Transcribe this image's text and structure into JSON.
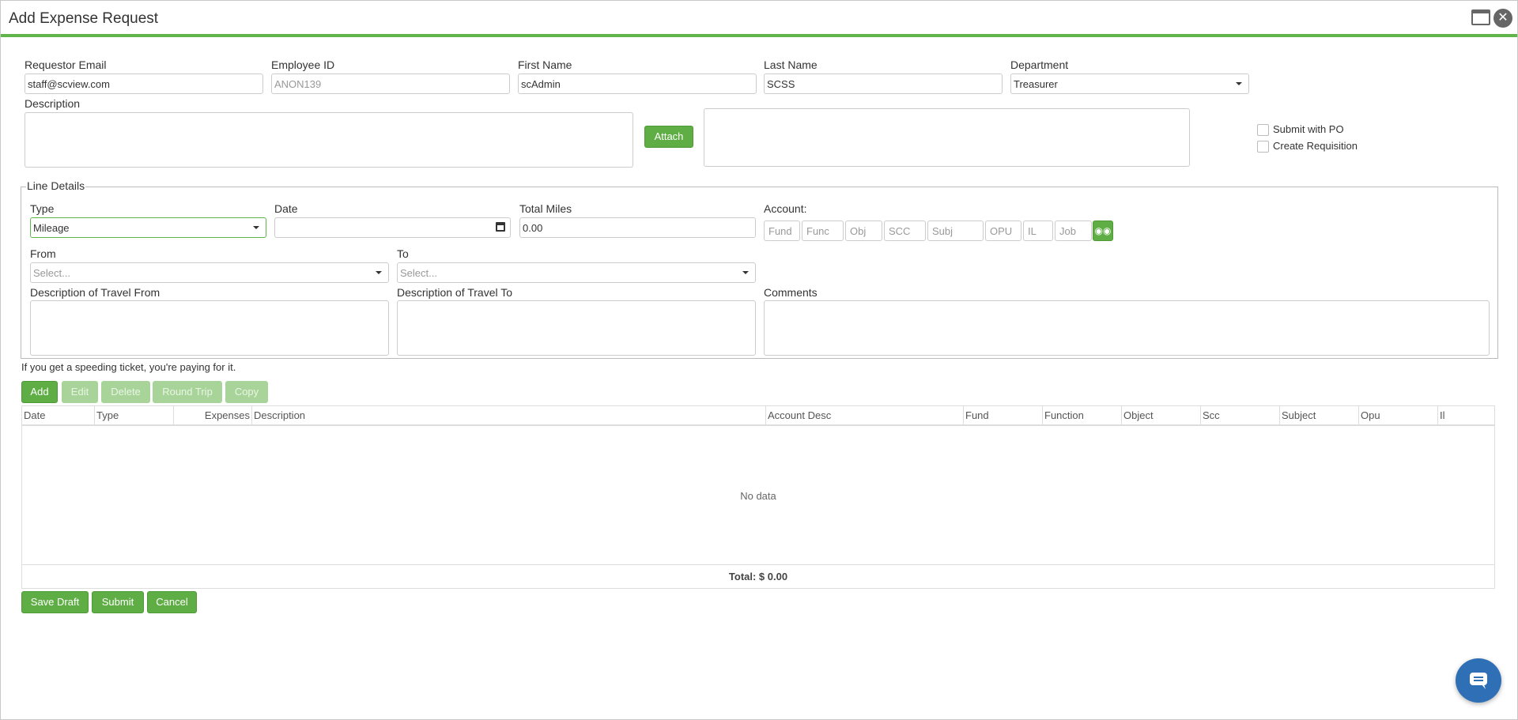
{
  "window": {
    "title": "Add Expense Request"
  },
  "header_fields": {
    "requestor_email": {
      "label": "Requestor Email",
      "value": "staff@scview.com"
    },
    "employee_id": {
      "label": "Employee ID",
      "value": "ANON139"
    },
    "first_name": {
      "label": "First Name",
      "value": "scAdmin"
    },
    "last_name": {
      "label": "Last Name",
      "value": "SCSS"
    },
    "department": {
      "label": "Department",
      "value": "Treasurer"
    },
    "description": {
      "label": "Description"
    },
    "attach_label": "Attach",
    "submit_with_po": "Submit with PO",
    "create_requisition": "Create Requisition"
  },
  "line_details": {
    "legend": "Line Details",
    "type": {
      "label": "Type",
      "value": "Mileage"
    },
    "date": {
      "label": "Date",
      "value": ""
    },
    "total_miles": {
      "label": "Total Miles",
      "value": "0.00"
    },
    "account": {
      "label": "Account:",
      "segments": [
        "Fund",
        "Func",
        "Obj",
        "SCC",
        "Subj",
        "OPU",
        "IL",
        "Job"
      ]
    },
    "from": {
      "label": "From",
      "placeholder": "Select..."
    },
    "to": {
      "label": "To",
      "placeholder": "Select..."
    },
    "desc_from": {
      "label": "Description of Travel From"
    },
    "desc_to": {
      "label": "Description of Travel To"
    },
    "comments": {
      "label": "Comments"
    }
  },
  "notice": "If you get a speeding ticket, you're paying for it.",
  "actions": {
    "add": "Add",
    "edit": "Edit",
    "delete": "Delete",
    "round_trip": "Round Trip",
    "copy": "Copy"
  },
  "grid": {
    "columns": [
      "Date",
      "Type",
      "Expenses",
      "Description",
      "Account Desc",
      "Fund",
      "Function",
      "Object",
      "Scc",
      "Subject",
      "Opu",
      "Il"
    ],
    "empty_text": "No data",
    "total": "Total: $ 0.00"
  },
  "footer": {
    "save_draft": "Save Draft",
    "submit": "Submit",
    "cancel": "Cancel"
  },
  "colors": {
    "accent": "#5fae45",
    "chat": "#2f6fb5"
  }
}
